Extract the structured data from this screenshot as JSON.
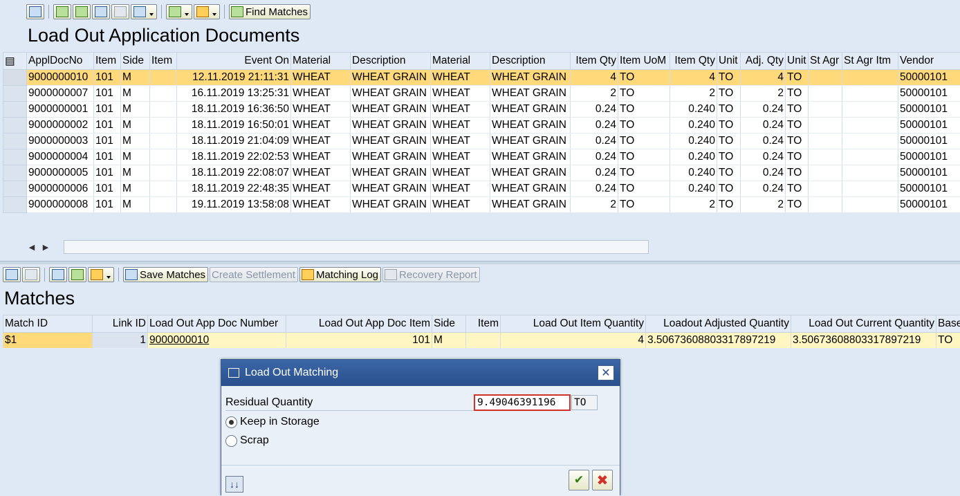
{
  "top_toolbar": {
    "find_matches": "Find Matches"
  },
  "top_title": "Load Out Application Documents",
  "top_table": {
    "columns": [
      "ApplDocNo",
      "Item",
      "Side",
      "Item",
      "Event On",
      "Material",
      "Description",
      "Material",
      "Description",
      "Item Qty",
      "Item UoM",
      "Item Qty",
      "Unit",
      "Adj. Qty",
      "Unit",
      "St Agr",
      "St Agr Itm",
      "Vendor"
    ],
    "rows": [
      [
        "9000000010",
        "101",
        "M",
        "",
        "12.11.2019 21:11:31",
        "WHEAT",
        "WHEAT GRAIN",
        "WHEAT",
        "WHEAT GRAIN",
        "4",
        "TO",
        "4",
        "TO",
        "4",
        "TO",
        "",
        "",
        "50000101"
      ],
      [
        "9000000007",
        "101",
        "M",
        "",
        "16.11.2019 13:25:31",
        "WHEAT",
        "WHEAT GRAIN",
        "WHEAT",
        "WHEAT GRAIN",
        "2",
        "TO",
        "2",
        "TO",
        "2",
        "TO",
        "",
        "",
        "50000101"
      ],
      [
        "9000000001",
        "101",
        "M",
        "",
        "18.11.2019 16:36:50",
        "WHEAT",
        "WHEAT GRAIN",
        "WHEAT",
        "WHEAT GRAIN",
        "0.24",
        "TO",
        "0.240",
        "TO",
        "0.24",
        "TO",
        "",
        "",
        "50000101"
      ],
      [
        "9000000002",
        "101",
        "M",
        "",
        "18.11.2019 16:50:01",
        "WHEAT",
        "WHEAT GRAIN",
        "WHEAT",
        "WHEAT GRAIN",
        "0.24",
        "TO",
        "0.240",
        "TO",
        "0.24",
        "TO",
        "",
        "",
        "50000101"
      ],
      [
        "9000000003",
        "101",
        "M",
        "",
        "18.11.2019 21:04:09",
        "WHEAT",
        "WHEAT GRAIN",
        "WHEAT",
        "WHEAT GRAIN",
        "0.24",
        "TO",
        "0.240",
        "TO",
        "0.24",
        "TO",
        "",
        "",
        "50000101"
      ],
      [
        "9000000004",
        "101",
        "M",
        "",
        "18.11.2019 22:02:53",
        "WHEAT",
        "WHEAT GRAIN",
        "WHEAT",
        "WHEAT GRAIN",
        "0.24",
        "TO",
        "0.240",
        "TO",
        "0.24",
        "TO",
        "",
        "",
        "50000101"
      ],
      [
        "9000000005",
        "101",
        "M",
        "",
        "18.11.2019 22:08:07",
        "WHEAT",
        "WHEAT GRAIN",
        "WHEAT",
        "WHEAT GRAIN",
        "0.24",
        "TO",
        "0.240",
        "TO",
        "0.24",
        "TO",
        "",
        "",
        "50000101"
      ],
      [
        "9000000006",
        "101",
        "M",
        "",
        "18.11.2019 22:48:35",
        "WHEAT",
        "WHEAT GRAIN",
        "WHEAT",
        "WHEAT GRAIN",
        "0.24",
        "TO",
        "0.240",
        "TO",
        "0.24",
        "TO",
        "",
        "",
        "50000101"
      ],
      [
        "9000000008",
        "101",
        "M",
        "",
        "19.11.2019 13:58:08",
        "WHEAT",
        "WHEAT GRAIN",
        "WHEAT",
        "WHEAT GRAIN",
        "2",
        "TO",
        "2",
        "TO",
        "2",
        "TO",
        "",
        "",
        "50000101"
      ]
    ]
  },
  "bottom_toolbar": {
    "save_matches": "Save Matches",
    "create_settlement": "Create Settlement",
    "matching_log": "Matching Log",
    "recovery_report": "Recovery Report"
  },
  "bottom_title": "Matches",
  "matches_table": {
    "columns": [
      "Match ID",
      "Link ID",
      "Load Out App Doc Number",
      "Load Out App Doc Item",
      "Side",
      "Item",
      "Load Out Item Quantity",
      "Loadout Adjusted Quantity",
      "Load Out Current Quantity",
      "Base"
    ],
    "rows": [
      [
        "$1",
        "1",
        "9000000010",
        "101",
        "M",
        "",
        "4",
        "3.50673608803317897219",
        "3.50673608803317897219",
        "TO"
      ]
    ]
  },
  "dialog": {
    "title": "Load Out Matching",
    "residual_label": "Residual Quantity",
    "residual_value": "9.49046391196",
    "residual_unit": "TO",
    "option_keep": "Keep in Storage",
    "option_scrap": "Scrap",
    "selected_option": "Keep in Storage"
  },
  "colors": {
    "selected_row": "#ffd97a",
    "match_row": "#fff6c2",
    "dialog_title_bar": "#2f5796",
    "background": "#dfe9f5"
  }
}
